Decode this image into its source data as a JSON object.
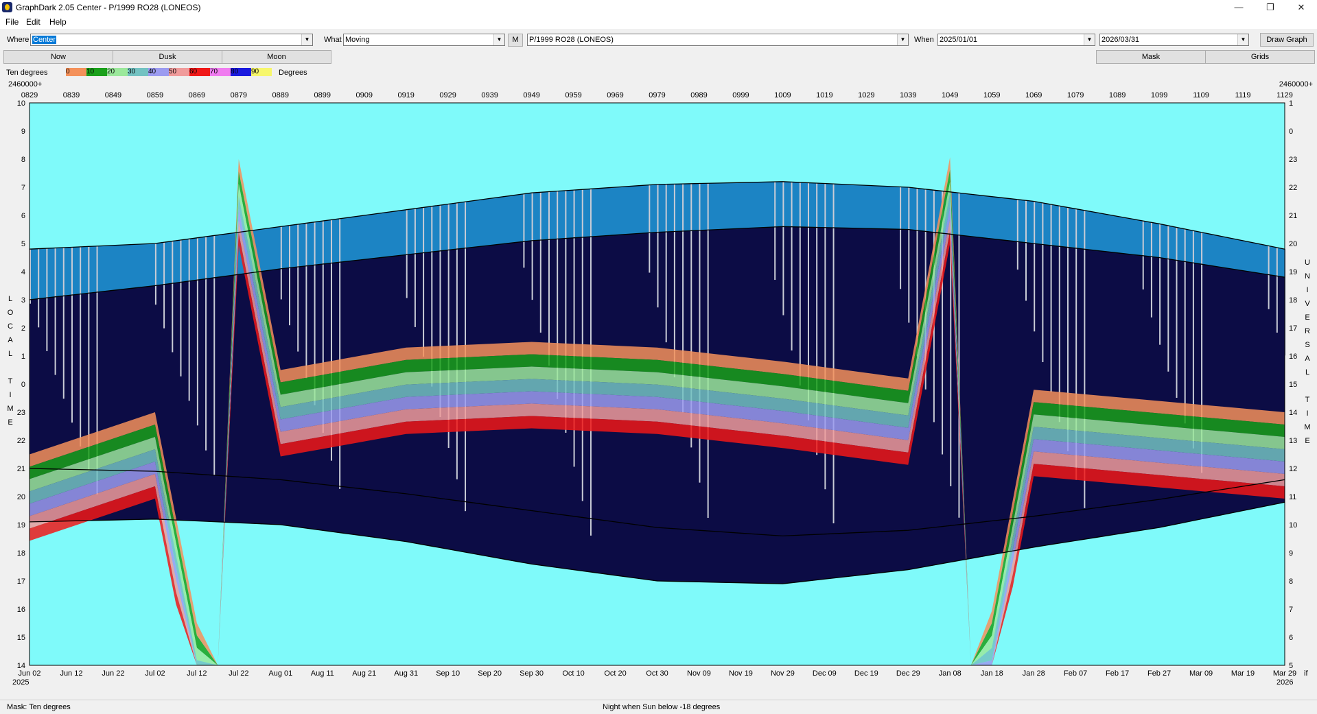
{
  "window": {
    "title": "GraphDark 2.05  Center  -  P/1999 RO28 (LONEOS)",
    "minimize": "—",
    "restore": "❐",
    "close": "✕"
  },
  "menu": [
    "File",
    "Edit",
    "Help"
  ],
  "toolbar": {
    "where_label": "Where",
    "where_value": "Center",
    "what_label": "What",
    "what_value": "Moving",
    "m_button": "M",
    "object_value": "P/1999 RO28 (LONEOS)",
    "when_label": "When",
    "when_start": "2025/01/01",
    "when_end": "2026/03/31",
    "draw_button": "Draw Graph"
  },
  "buttons": {
    "now": "Now",
    "dusk": "Dusk",
    "moon": "Moon",
    "mask": "Mask",
    "grids": "Grids"
  },
  "legend": {
    "label": "Ten degrees",
    "unit": "Degrees",
    "items": [
      {
        "text": "0",
        "color": "#f4915a"
      },
      {
        "text": "10",
        "color": "#1aa01a"
      },
      {
        "text": "20",
        "color": "#9be89b"
      },
      {
        "text": "30",
        "color": "#73c2c2"
      },
      {
        "text": "40",
        "color": "#9b9bf0"
      },
      {
        "text": "50",
        "color": "#f09b9b"
      },
      {
        "text": "60",
        "color": "#f01818"
      },
      {
        "text": "70",
        "color": "#f07cf0"
      },
      {
        "text": "80",
        "color": "#1a1adf"
      },
      {
        "text": "90",
        "color": "#f7f76c"
      }
    ]
  },
  "chart_data": {
    "type": "heatmap",
    "jd_prefix_left": "2460000+",
    "jd_prefix_right": "2460000+",
    "top_ticks": [
      "0829",
      "0839",
      "0849",
      "0859",
      "0869",
      "0879",
      "0889",
      "0899",
      "0909",
      "0919",
      "0929",
      "0939",
      "0949",
      "0959",
      "0969",
      "0979",
      "0989",
      "0999",
      "1009",
      "1019",
      "1029",
      "1039",
      "1049",
      "1059",
      "1069",
      "1079",
      "1089",
      "1099",
      "1109",
      "1119",
      "1129"
    ],
    "bottom_ticks": [
      "Jun 02",
      "Jun 12",
      "Jun 22",
      "Jul 02",
      "Jul 12",
      "Jul 22",
      "Aug 01",
      "Aug 11",
      "Aug 21",
      "Aug 31",
      "Sep 10",
      "Sep 20",
      "Sep 30",
      "Oct 10",
      "Oct 20",
      "Oct 30",
      "Nov 09",
      "Nov 19",
      "Nov 29",
      "Dec 09",
      "Dec 19",
      "Dec 29",
      "Jan 08",
      "Jan 18",
      "Jan 28",
      "Feb 07",
      "Feb 17",
      "Feb 27",
      "Mar 09",
      "Mar 19",
      "Mar 29"
    ],
    "year_left": "2025",
    "year_right": "2026",
    "corner_right": "if",
    "left_ticks": [
      "10",
      "9",
      "8",
      "7",
      "6",
      "5",
      "4",
      "3",
      "2",
      "1",
      "0",
      "23",
      "22",
      "21",
      "20",
      "19",
      "18",
      "17",
      "16",
      "15",
      "14"
    ],
    "right_ticks": [
      "1",
      "0",
      "23",
      "22",
      "21",
      "20",
      "19",
      "18",
      "17",
      "16",
      "15",
      "14",
      "13",
      "12",
      "11",
      "10",
      "9",
      "8",
      "7",
      "6",
      "5"
    ],
    "left_axis_letters": [
      "L",
      "O",
      "C",
      "A",
      "L",
      "",
      "T",
      "I",
      "M",
      "E"
    ],
    "right_axis_letters": [
      "U",
      "N",
      "I",
      "V",
      "E",
      "R",
      "S",
      "A",
      "L",
      "",
      "T",
      "I",
      "M",
      "E"
    ],
    "night_edges": {
      "days": [
        0,
        30,
        60,
        90,
        120,
        150,
        180,
        210,
        240,
        270,
        300
      ],
      "dusk_local": [
        4.8,
        5.0,
        5.6,
        6.2,
        6.8,
        7.1,
        7.2,
        7.0,
        6.5,
        5.7,
        4.8
      ],
      "dawn_local": [
        19.1,
        19.2,
        19.0,
        18.4,
        17.6,
        17.0,
        16.9,
        17.4,
        18.2,
        18.9,
        19.8
      ],
      "dusk_astro": [
        3.0,
        3.5,
        4.1,
        4.6,
        5.1,
        5.4,
        5.6,
        5.5,
        5.0,
        4.5,
        3.8
      ],
      "dawn_astro": [
        21.0,
        20.9,
        20.6,
        20.1,
        19.5,
        18.9,
        18.6,
        18.8,
        19.3,
        19.9,
        20.6
      ]
    },
    "object_track_days": [
      0,
      30,
      60,
      90,
      120,
      150,
      180,
      210,
      240,
      270,
      300
    ],
    "object_track_hour": [
      21.5,
      23.0,
      0.5,
      1.3,
      1.5,
      1.3,
      0.8,
      0.2,
      23.8,
      23.4,
      23.0
    ]
  },
  "status": {
    "mask": "Mask:  Ten degrees",
    "info": "Night when Sun below -18 degrees"
  }
}
